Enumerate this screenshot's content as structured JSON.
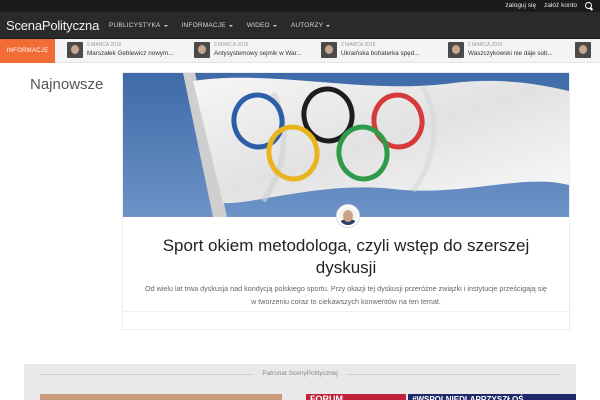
{
  "topbar": {
    "login": "zaloguj się",
    "register": "załóż konto",
    "search_icon": "search-icon"
  },
  "nav": {
    "logo": "ScenaPolityczna",
    "items": [
      {
        "label": "PUBLICYSTYKA"
      },
      {
        "label": "INFORMACJE"
      },
      {
        "label": "WIDEO"
      },
      {
        "label": "AUTORZY"
      }
    ]
  },
  "ticker": {
    "label": "INFORMACJE",
    "items": [
      {
        "date": "5 MARCA 2016",
        "title": "Marszałek Geblewicz nowym..."
      },
      {
        "date": "3 MARCA 2016",
        "title": "Antysystemowy sejmik w War..."
      },
      {
        "date": "2 MARCA 2016",
        "title": "Ukraińska bohaterka spęd..."
      },
      {
        "date": "2 MARCA 2016",
        "title": "Waszczykowski nie daje sob..."
      }
    ]
  },
  "main": {
    "section_title": "Najnowsze",
    "article": {
      "title": "Sport okiem metodologa, czyli wstęp do szerszej dyskusji",
      "excerpt": "Od wielu lat trwa dyskusja nad kondycją polskiego sportu. Przy okazji tej dyskusji przeróżne związki i instytucje prześcigają się w tworzeniu coraz to ciekawszych konwentów na ten temat."
    }
  },
  "bottom": {
    "patronat": "Patronat ScenyPolitycznej",
    "forum_text": "FORUM",
    "hashtag": "#WSPOLNIEDLAPRZYSZŁOŚ"
  },
  "colors": {
    "accent": "#f26c36",
    "nav_bg": "#2a2a2a",
    "topbar_bg": "#1b1b1b"
  }
}
